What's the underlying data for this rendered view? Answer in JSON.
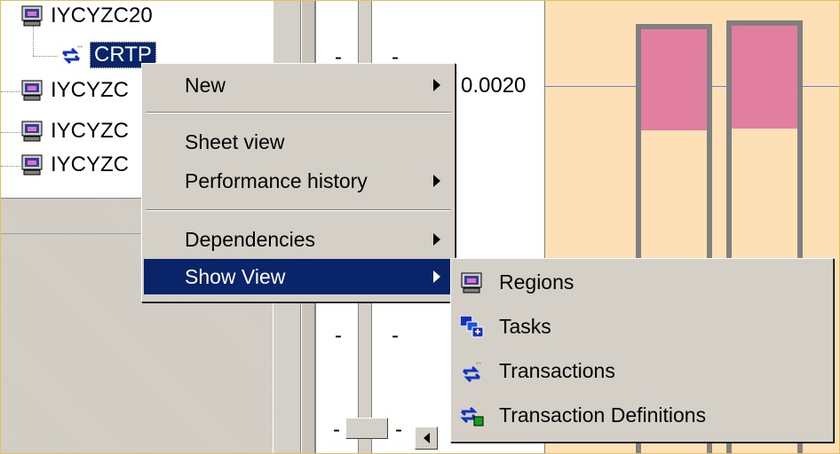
{
  "tree": {
    "items": [
      {
        "label": "IYCYZC20",
        "icon": "region-icon"
      },
      {
        "label": "CRTP",
        "icon": "transaction-icon",
        "selected": true
      },
      {
        "label": "IYCYZC",
        "icon": "region-icon"
      },
      {
        "label": "IYCYZC",
        "icon": "region-icon"
      },
      {
        "label": "IYCYZC",
        "icon": "region-icon"
      }
    ]
  },
  "grid": {
    "cells": [
      "-",
      "-",
      "0.0020",
      "-",
      "-",
      "-",
      "-"
    ]
  },
  "context_menu": {
    "items": [
      {
        "label": "New",
        "submenu": true
      },
      {
        "label": "Sheet view",
        "submenu": false
      },
      {
        "label": "Performance history",
        "submenu": true
      },
      {
        "label": "Dependencies",
        "submenu": true
      },
      {
        "label": "Show View",
        "submenu": true,
        "highlighted": true
      }
    ]
  },
  "submenu": {
    "items": [
      {
        "label": "Regions",
        "icon": "regions-icon"
      },
      {
        "label": "Tasks",
        "icon": "tasks-icon"
      },
      {
        "label": "Transactions",
        "icon": "transactions-icon"
      },
      {
        "label": "Transaction Definitions",
        "icon": "transaction-definitions-icon"
      }
    ]
  },
  "colors": {
    "selection": "#0a246a",
    "chart_background": "#fde0b6",
    "bar_top": "#e27ea0",
    "reference_line": "#6a80d8",
    "menu_background": "#d4d0c8"
  }
}
